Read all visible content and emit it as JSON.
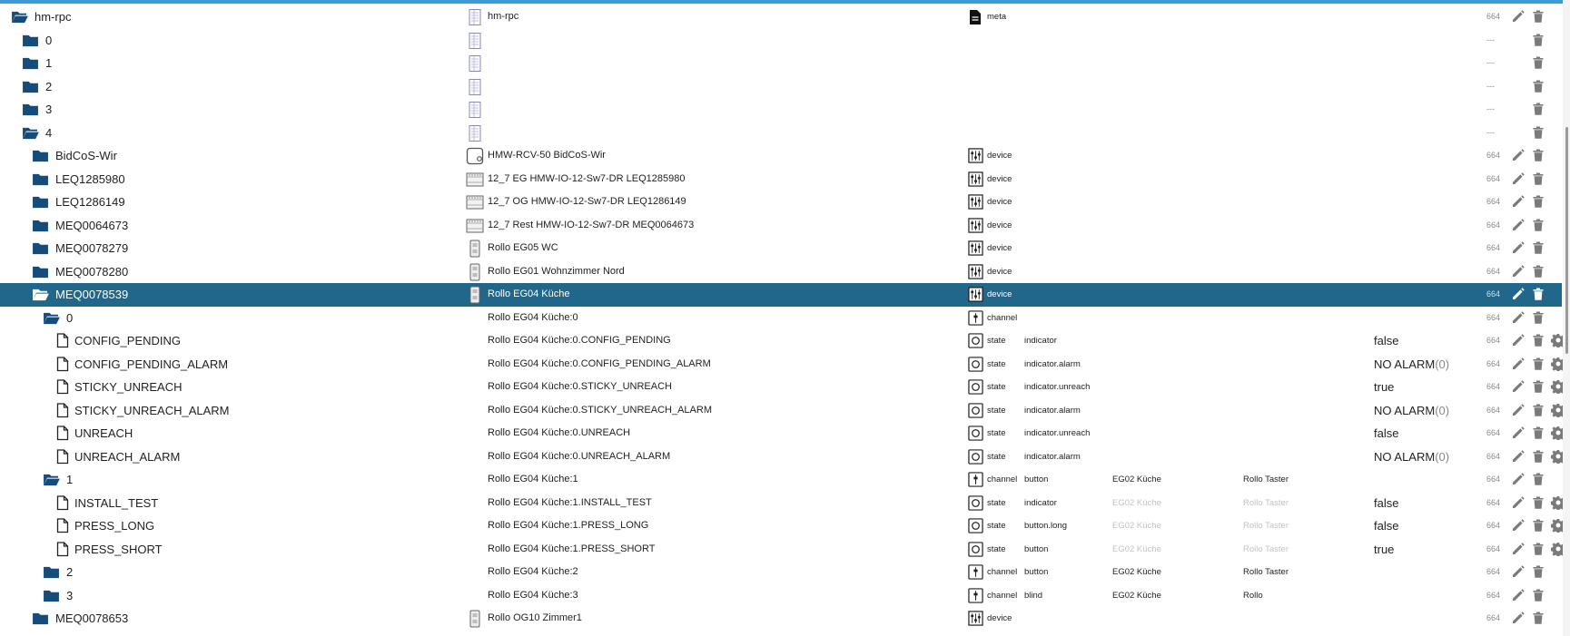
{
  "colors": {
    "accent": "#3c9ad6",
    "selected_row": "#21678c",
    "folder": "#164c7a",
    "icon_gray": "#7a7a7a"
  },
  "rows": [
    {
      "indent": 0,
      "icon": "folder-open-icon",
      "name": "hm-rpc",
      "obj_icon": "adapter-icon",
      "obj_name": "hm-rpc",
      "type_icon": "meta-icon",
      "type": "meta",
      "acl": "664",
      "actions": [
        "edit",
        "delete"
      ]
    },
    {
      "indent": 1,
      "icon": "folder-icon",
      "name": "0",
      "obj_icon": "adapter-icon",
      "acl": "---",
      "actions": [
        "delete"
      ]
    },
    {
      "indent": 1,
      "icon": "folder-icon",
      "name": "1",
      "obj_icon": "adapter-icon",
      "acl": "---",
      "actions": [
        "delete"
      ]
    },
    {
      "indent": 1,
      "icon": "folder-icon",
      "name": "2",
      "obj_icon": "adapter-icon",
      "acl": "---",
      "actions": [
        "delete"
      ]
    },
    {
      "indent": 1,
      "icon": "folder-icon",
      "name": "3",
      "obj_icon": "adapter-icon",
      "acl": "---",
      "actions": [
        "delete"
      ]
    },
    {
      "indent": 1,
      "icon": "folder-open-icon",
      "name": "4",
      "obj_icon": "adapter-icon",
      "acl": "---",
      "actions": [
        "delete"
      ]
    },
    {
      "indent": 2,
      "icon": "folder-icon",
      "name": "BidCoS-Wir",
      "obj_icon": "wired-ccu-icon",
      "obj_name": "HMW-RCV-50 BidCoS-Wir",
      "type_icon": "device-icon",
      "type": "device",
      "acl": "664",
      "actions": [
        "edit",
        "delete"
      ]
    },
    {
      "indent": 2,
      "icon": "folder-icon",
      "name": "LEQ1285980",
      "obj_icon": "io-module-icon",
      "obj_name": "12_7 EG HMW-IO-12-Sw7-DR LEQ1285980",
      "type_icon": "device-icon",
      "type": "device",
      "acl": "664",
      "actions": [
        "edit",
        "delete"
      ]
    },
    {
      "indent": 2,
      "icon": "folder-icon",
      "name": "LEQ1286149",
      "obj_icon": "io-module-icon",
      "obj_name": "12_7 OG HMW-IO-12-Sw7-DR LEQ1286149",
      "type_icon": "device-icon",
      "type": "device",
      "acl": "664",
      "actions": [
        "edit",
        "delete"
      ]
    },
    {
      "indent": 2,
      "icon": "folder-icon",
      "name": "MEQ0064673",
      "obj_icon": "io-module-icon",
      "obj_name": "12_7 Rest HMW-IO-12-Sw7-DR MEQ0064673",
      "type_icon": "device-icon",
      "type": "device",
      "acl": "664",
      "actions": [
        "edit",
        "delete"
      ]
    },
    {
      "indent": 2,
      "icon": "folder-icon",
      "name": "MEQ0078279",
      "obj_icon": "blind-switch-icon",
      "obj_name": "Rollo EG05 WC",
      "type_icon": "device-icon",
      "type": "device",
      "acl": "664",
      "actions": [
        "edit",
        "delete"
      ]
    },
    {
      "indent": 2,
      "icon": "folder-icon",
      "name": "MEQ0078280",
      "obj_icon": "blind-switch-icon",
      "obj_name": "Rollo EG01 Wohnzimmer Nord",
      "type_icon": "device-icon",
      "type": "device",
      "acl": "664",
      "actions": [
        "edit",
        "delete"
      ]
    },
    {
      "indent": 2,
      "icon": "folder-open-icon",
      "name": "MEQ0078539",
      "selected": true,
      "obj_icon": "blind-switch-icon",
      "obj_name": "Rollo EG04 Küche",
      "type_icon": "device-icon",
      "type": "device",
      "acl": "664",
      "actions": [
        "edit",
        "delete"
      ]
    },
    {
      "indent": 3,
      "icon": "folder-open-icon",
      "name": "0",
      "obj_name": "Rollo EG04 Küche:0",
      "type_icon": "channel-icon",
      "type": "channel",
      "acl": "664",
      "actions": [
        "edit",
        "delete"
      ]
    },
    {
      "indent": 4,
      "icon": "file-icon",
      "name": "CONFIG_PENDING",
      "obj_name": "Rollo EG04 Küche:0.CONFIG_PENDING",
      "type_icon": "state-icon",
      "type": "state",
      "role": "indicator",
      "value": "false",
      "acl": "664",
      "actions": [
        "edit",
        "delete",
        "settings"
      ]
    },
    {
      "indent": 4,
      "icon": "file-icon",
      "name": "CONFIG_PENDING_ALARM",
      "obj_name": "Rollo EG04 Küche:0.CONFIG_PENDING_ALARM",
      "type_icon": "state-icon",
      "type": "state",
      "role": "indicator.alarm",
      "value": "NO ALARM",
      "value_sub": "(0)",
      "acl": "664",
      "actions": [
        "edit",
        "delete",
        "settings"
      ]
    },
    {
      "indent": 4,
      "icon": "file-icon",
      "name": "STICKY_UNREACH",
      "obj_name": "Rollo EG04 Küche:0.STICKY_UNREACH",
      "type_icon": "state-icon",
      "type": "state",
      "role": "indicator.unreach",
      "value": "true",
      "acl": "664",
      "actions": [
        "edit",
        "delete",
        "settings"
      ]
    },
    {
      "indent": 4,
      "icon": "file-icon",
      "name": "STICKY_UNREACH_ALARM",
      "obj_name": "Rollo EG04 Küche:0.STICKY_UNREACH_ALARM",
      "type_icon": "state-icon",
      "type": "state",
      "role": "indicator.alarm",
      "value": "NO ALARM",
      "value_sub": "(0)",
      "acl": "664",
      "actions": [
        "edit",
        "delete",
        "settings"
      ]
    },
    {
      "indent": 4,
      "icon": "file-icon",
      "name": "UNREACH",
      "obj_name": "Rollo EG04 Küche:0.UNREACH",
      "type_icon": "state-icon",
      "type": "state",
      "role": "indicator.unreach",
      "value": "false",
      "acl": "664",
      "actions": [
        "edit",
        "delete",
        "settings"
      ]
    },
    {
      "indent": 4,
      "icon": "file-icon",
      "name": "UNREACH_ALARM",
      "obj_name": "Rollo EG04 Küche:0.UNREACH_ALARM",
      "type_icon": "state-icon",
      "type": "state",
      "role": "indicator.alarm",
      "value": "NO ALARM",
      "value_sub": "(0)",
      "acl": "664",
      "actions": [
        "edit",
        "delete",
        "settings"
      ]
    },
    {
      "indent": 3,
      "icon": "folder-open-icon",
      "name": "1",
      "obj_name": "Rollo EG04 Küche:1",
      "type_icon": "channel-icon",
      "type": "channel",
      "role": "button",
      "room": "EG02 Küche",
      "func": "Rollo Taster",
      "acl": "664",
      "actions": [
        "edit",
        "delete"
      ]
    },
    {
      "indent": 4,
      "icon": "file-icon",
      "name": "INSTALL_TEST",
      "obj_name": "Rollo EG04 Küche:1.INSTALL_TEST",
      "type_icon": "state-icon",
      "type": "state",
      "role": "indicator",
      "room": "EG02 Küche",
      "func": "Rollo Taster",
      "inherited": true,
      "value": "false",
      "acl": "664",
      "actions": [
        "edit",
        "delete",
        "settings"
      ]
    },
    {
      "indent": 4,
      "icon": "file-icon",
      "name": "PRESS_LONG",
      "obj_name": "Rollo EG04 Küche:1.PRESS_LONG",
      "type_icon": "state-icon",
      "type": "state",
      "role": "button.long",
      "room": "EG02 Küche",
      "func": "Rollo Taster",
      "inherited": true,
      "value": "false",
      "acl": "664",
      "actions": [
        "edit",
        "delete",
        "settings"
      ]
    },
    {
      "indent": 4,
      "icon": "file-icon",
      "name": "PRESS_SHORT",
      "obj_name": "Rollo EG04 Küche:1.PRESS_SHORT",
      "type_icon": "state-icon",
      "type": "state",
      "role": "button",
      "room": "EG02 Küche",
      "func": "Rollo Taster",
      "inherited": true,
      "value": "true",
      "acl": "664",
      "actions": [
        "edit",
        "delete",
        "settings"
      ]
    },
    {
      "indent": 3,
      "icon": "folder-icon",
      "name": "2",
      "obj_name": "Rollo EG04 Küche:2",
      "type_icon": "channel-icon",
      "type": "channel",
      "role": "button",
      "room": "EG02 Küche",
      "func": "Rollo Taster",
      "acl": "664",
      "actions": [
        "edit",
        "delete"
      ]
    },
    {
      "indent": 3,
      "icon": "folder-icon",
      "name": "3",
      "obj_name": "Rollo EG04 Küche:3",
      "type_icon": "channel-icon",
      "type": "channel",
      "role": "blind",
      "room": "EG02 Küche",
      "func": "Rollo",
      "acl": "664",
      "actions": [
        "edit",
        "delete"
      ]
    },
    {
      "indent": 2,
      "icon": "folder-icon",
      "name": "MEQ0078653",
      "obj_icon": "blind-switch-icon",
      "obj_name": "Rollo OG10 Zimmer1",
      "type_icon": "device-icon",
      "type": "device",
      "acl": "664",
      "actions": [
        "edit",
        "delete"
      ]
    }
  ]
}
